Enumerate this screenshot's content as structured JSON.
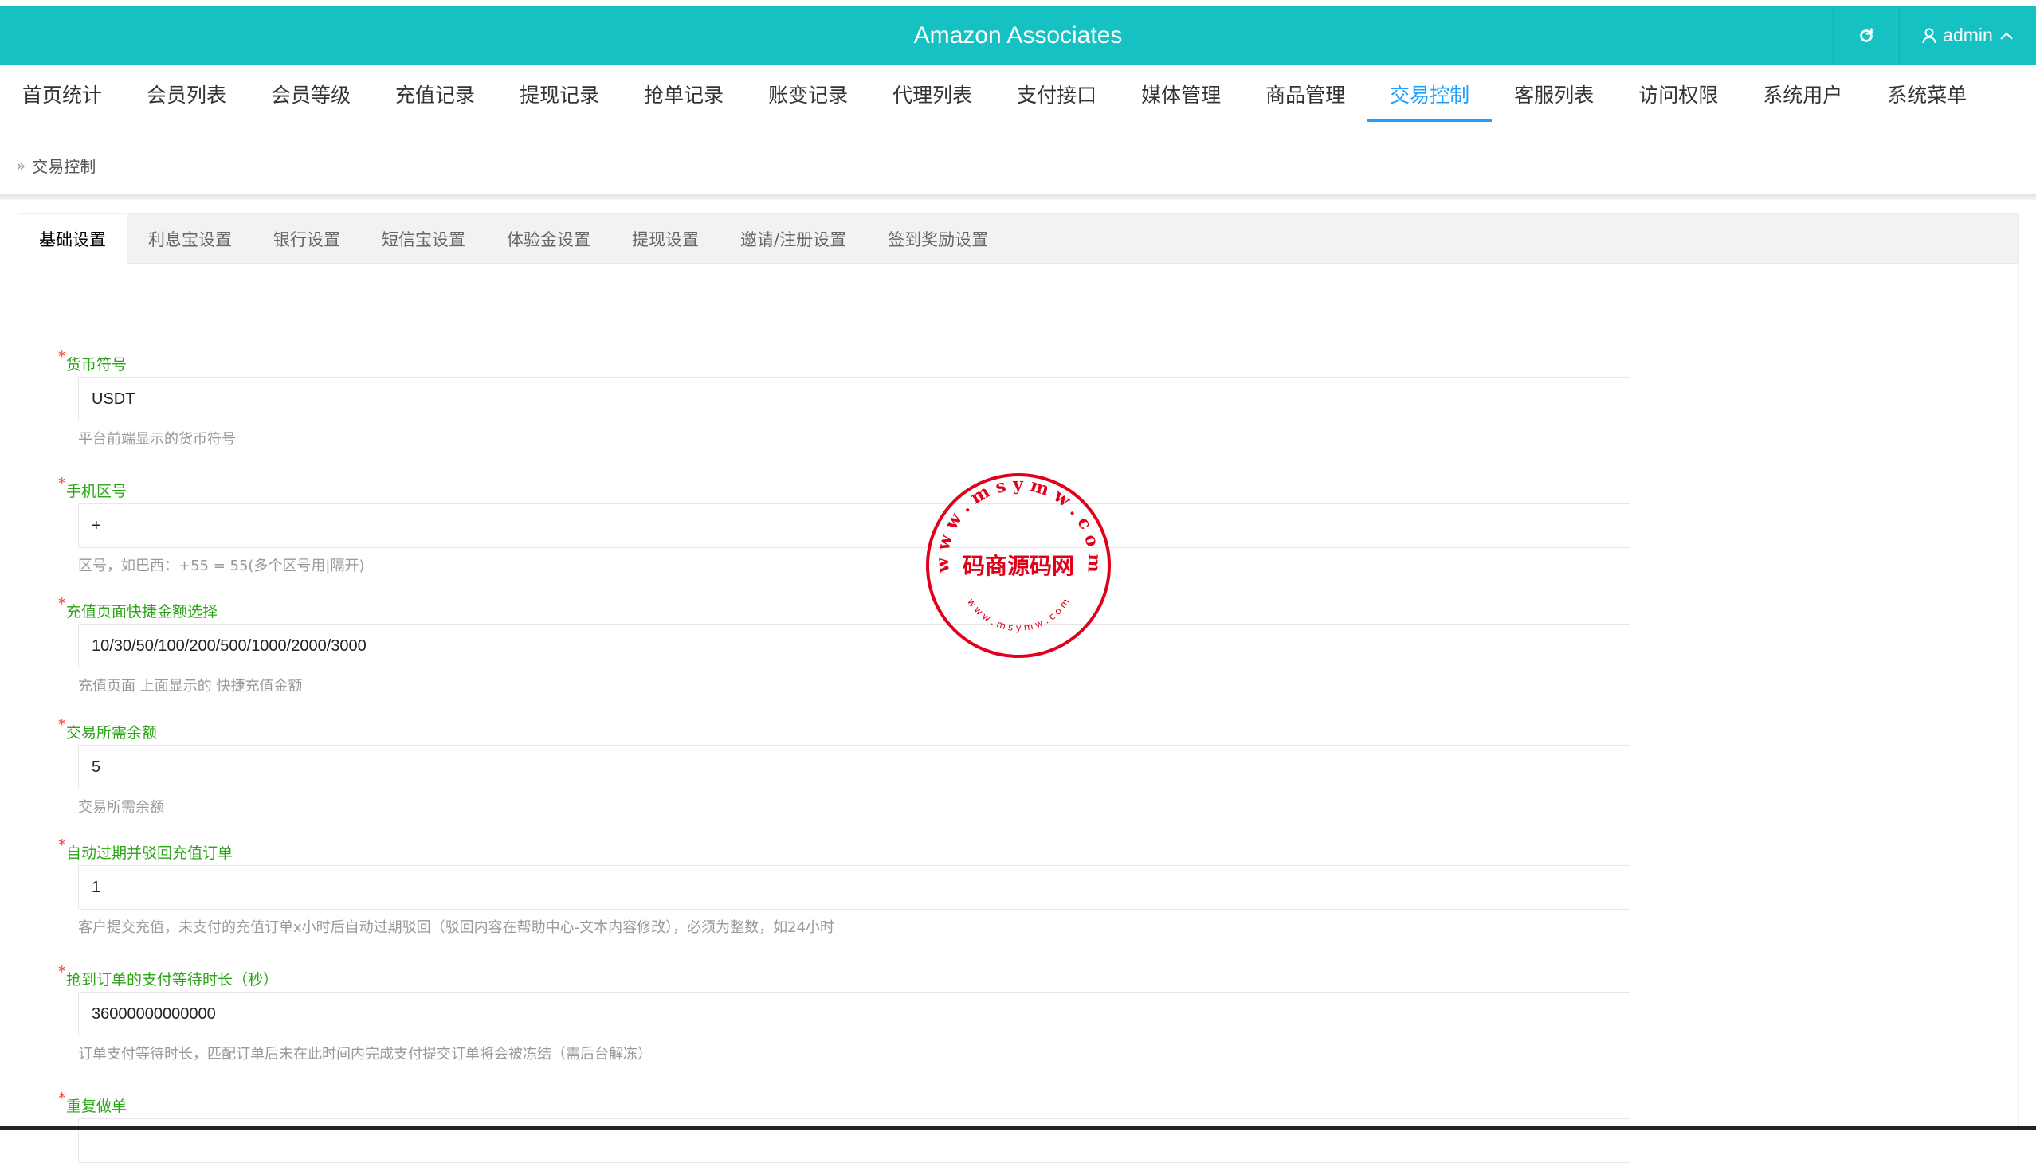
{
  "header": {
    "brand": "Amazon Associates",
    "user": "admin",
    "refresh_icon": "refresh-icon",
    "user_icon": "user-icon",
    "chevron_icon": "chevron-up-icon",
    "color": "#16c1c3"
  },
  "nav": {
    "items": [
      "首页统计",
      "会员列表",
      "会员等级",
      "充值记录",
      "提现记录",
      "抢单记录",
      "账变记录",
      "代理列表",
      "支付接口",
      "媒体管理",
      "商品管理",
      "交易控制",
      "客服列表",
      "访问权限",
      "系统用户",
      "系统菜单"
    ],
    "active_index": 11,
    "active_color": "#1e9fff"
  },
  "breadcrumb": {
    "text": "交易控制"
  },
  "tabs": {
    "items": [
      "基础设置",
      "利息宝设置",
      "银行设置",
      "短信宝设置",
      "体验金设置",
      "提现设置",
      "邀请/注册设置",
      "签到奖励设置"
    ],
    "active_index": 0
  },
  "form": {
    "required_mark": "*",
    "fields": [
      {
        "label": "货币符号",
        "value": "USDT",
        "help": "平台前端显示的货币符号"
      },
      {
        "label": "手机区号",
        "value": "+",
        "help": "区号，如巴西：+55 = 55(多个区号用|隔开)"
      },
      {
        "label": "充值页面快捷金额选择",
        "value": "10/30/50/100/200/500/1000/2000/3000",
        "help": "充值页面 上面显示的 快捷充值金额"
      },
      {
        "label": "交易所需余额",
        "value": "5",
        "help": "交易所需余额"
      },
      {
        "label": "自动过期并驳回充值订单",
        "value": "1",
        "help": "客户提交充值，未支付的充值订单x小时后自动过期驳回（驳回内容在帮助中心-文本内容修改），必须为整数，如24小时"
      },
      {
        "label": "抢到订单的支付等待时长（秒）",
        "value": "36000000000000",
        "help": "订单支付等待时长，匹配订单后未在此时间内完成支付提交订单将会被冻结（需后台解冻）"
      },
      {
        "label": "重复做单",
        "value": "",
        "help": ""
      }
    ]
  },
  "watermark": {
    "top_text": "w w w . m s y m w . c o m",
    "center_text": "码商源码网",
    "bottom_text": "w w w . m s y m w . c o m",
    "color": "#e0001a"
  }
}
